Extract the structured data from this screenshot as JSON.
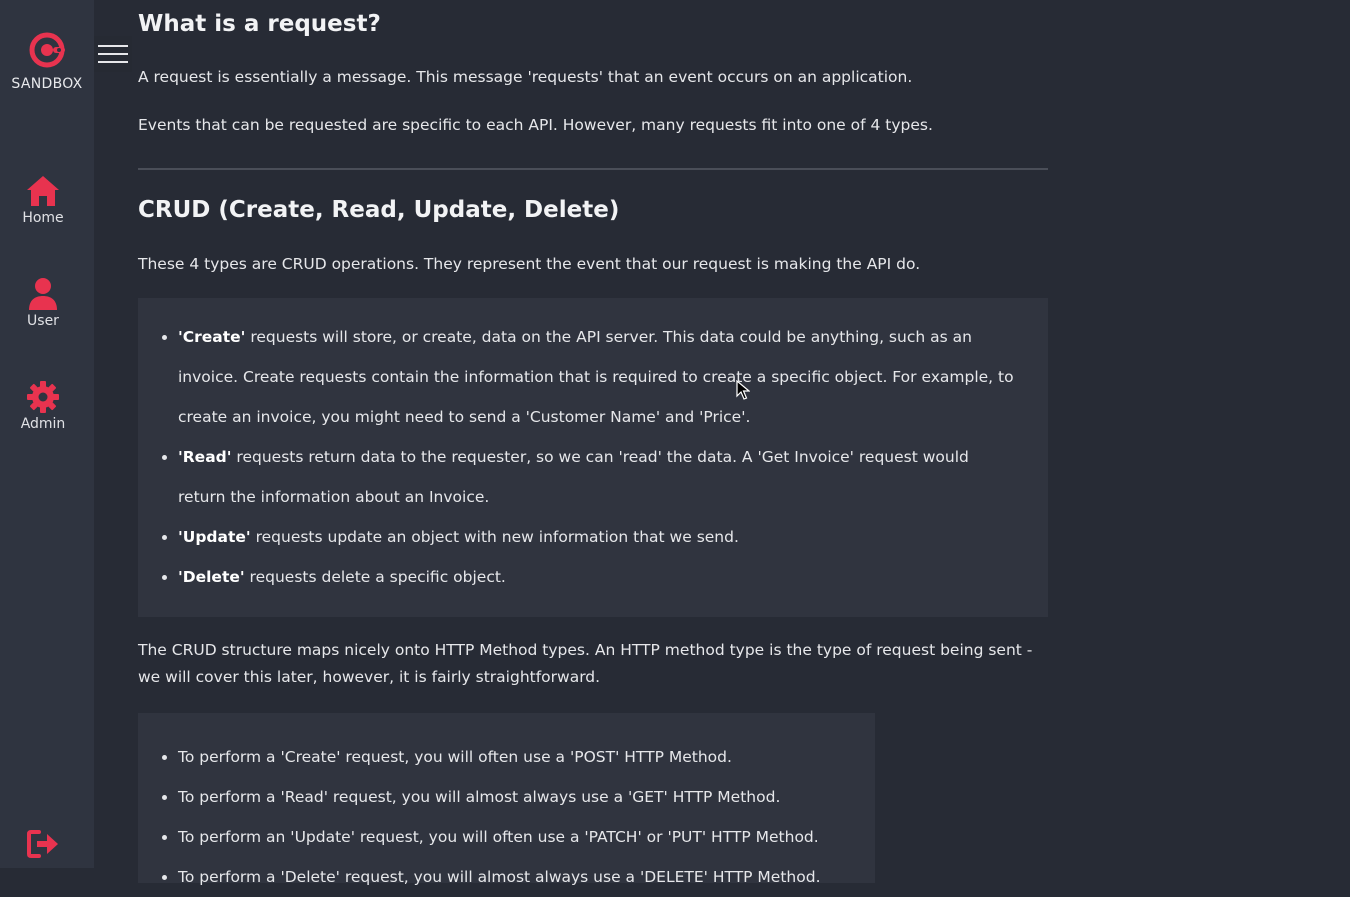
{
  "sidebar": {
    "logo_text": "SANDBOX",
    "items": [
      {
        "label": "Home",
        "icon": "home-icon"
      },
      {
        "label": "User",
        "icon": "user-icon"
      },
      {
        "label": "Admin",
        "icon": "gear-icon"
      }
    ],
    "logout_icon": "logout-icon"
  },
  "colors": {
    "accent": "#e8334f",
    "background": "#272b35",
    "sidebar": "#2f3440",
    "panel": "#30343f"
  },
  "main": {
    "heading1": "What is a request?",
    "p1": "A request is essentially a message. This message 'requests' that an event occurs on an application.",
    "p2": "Events that can be requested are specific to each API. However, many requests fit into one of 4 types.",
    "heading2": "CRUD (Create, Read, Update, Delete)",
    "p3": "These 4 types are CRUD operations. They represent the event that our request is making the API do.",
    "crud_list": [
      {
        "term": "'Create'",
        "text": " requests will store, or create, data on the API server. This data could be anything, such as an invoice. Create requests contain the information that is required to create a specific object. For example, to create an invoice, you might need to send a 'Customer Name' and 'Price'."
      },
      {
        "term": "'Read'",
        "text": " requests return data to the requester, so we can 'read' the data. A 'Get Invoice' request would return the information about an Invoice."
      },
      {
        "term": "'Update'",
        "text": " requests update an object with new information that we send."
      },
      {
        "term": "'Delete'",
        "text": " requests delete a specific object."
      }
    ],
    "p4": "The CRUD structure maps nicely onto HTTP Method types. An HTTP method type is the type of request being sent - we will cover this later, however, it is fairly straightforward.",
    "http_list": [
      "To perform a 'Create' request, you will often use a 'POST' HTTP Method.",
      "To perform a 'Read' request, you will almost always use a 'GET' HTTP Method.",
      "To perform an 'Update' request, you will often use a 'PATCH' or 'PUT' HTTP Method.",
      "To perform a 'Delete' request, you will almost always use a 'DELETE' HTTP Method."
    ]
  }
}
